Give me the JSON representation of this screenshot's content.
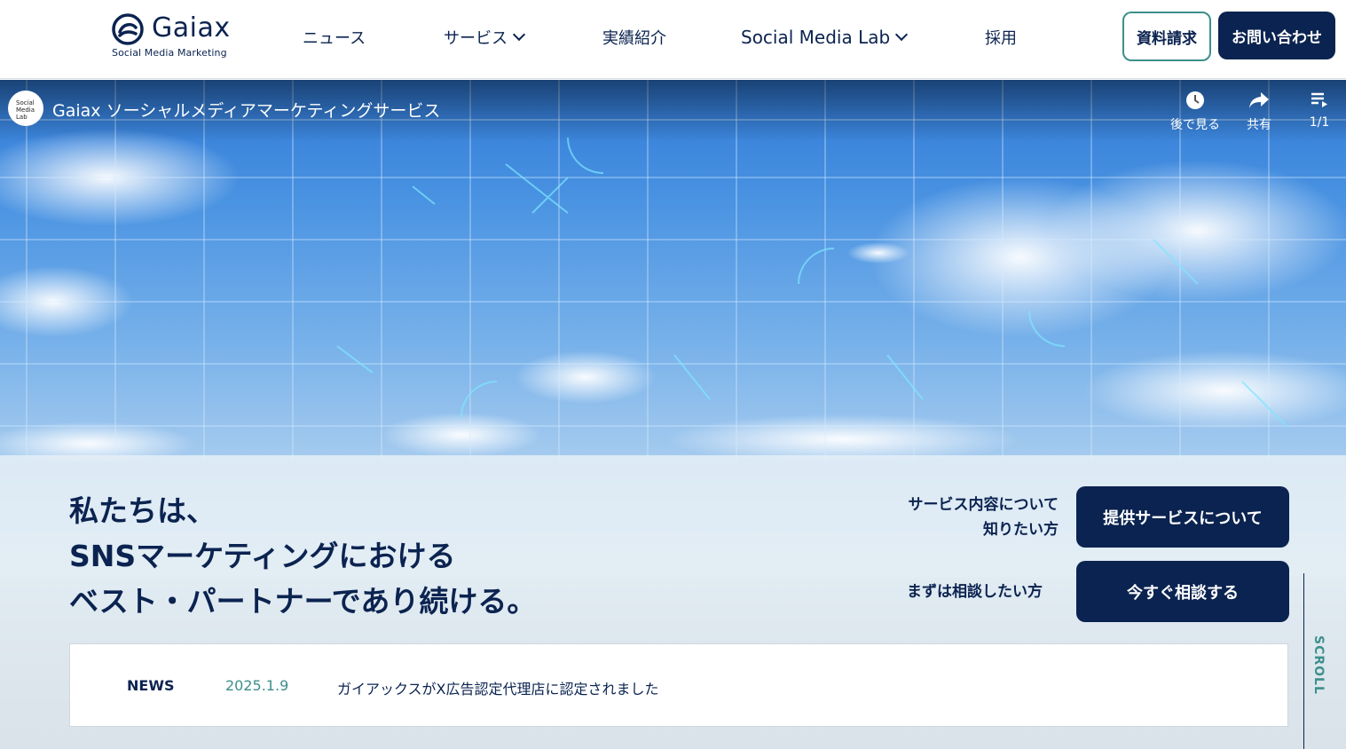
{
  "header": {
    "logo_name": "Gaiax",
    "logo_tagline": "Social Media Marketing",
    "nav": [
      {
        "label": "ニュース"
      },
      {
        "label": "サービス"
      },
      {
        "label": "実績紹介"
      },
      {
        "label": "Social Media Lab"
      },
      {
        "label": "採用"
      }
    ],
    "doc_button": "資料請求",
    "contact_button": "お問い合わせ"
  },
  "video": {
    "channel_avatar_text": "Social Media Lab",
    "title": "Gaiax ソーシャルメディアマーケティングサービス",
    "watch_later": "後で見る",
    "share": "共有",
    "playlist": "1/1"
  },
  "hero": {
    "headline_lines": [
      "私たちは、",
      "SNSマーケティングにおける",
      "ベスト・パートナーであり続ける。"
    ],
    "cta1_text_lines": [
      "サービス内容について",
      "知りたい方"
    ],
    "cta1_button": "提供サービスについて",
    "cta2_text": "まずは相談したい方",
    "cta2_button": "今すぐ相談する"
  },
  "news": {
    "label": "NEWS",
    "date": "2025.1.9",
    "text": "ガイアックスがX広告認定代理店に認定されました"
  },
  "scroll_label": "SCROLL",
  "colors": {
    "navy": "#0b2350",
    "teal": "#3c8f8a",
    "sky": "#4a93e2"
  }
}
